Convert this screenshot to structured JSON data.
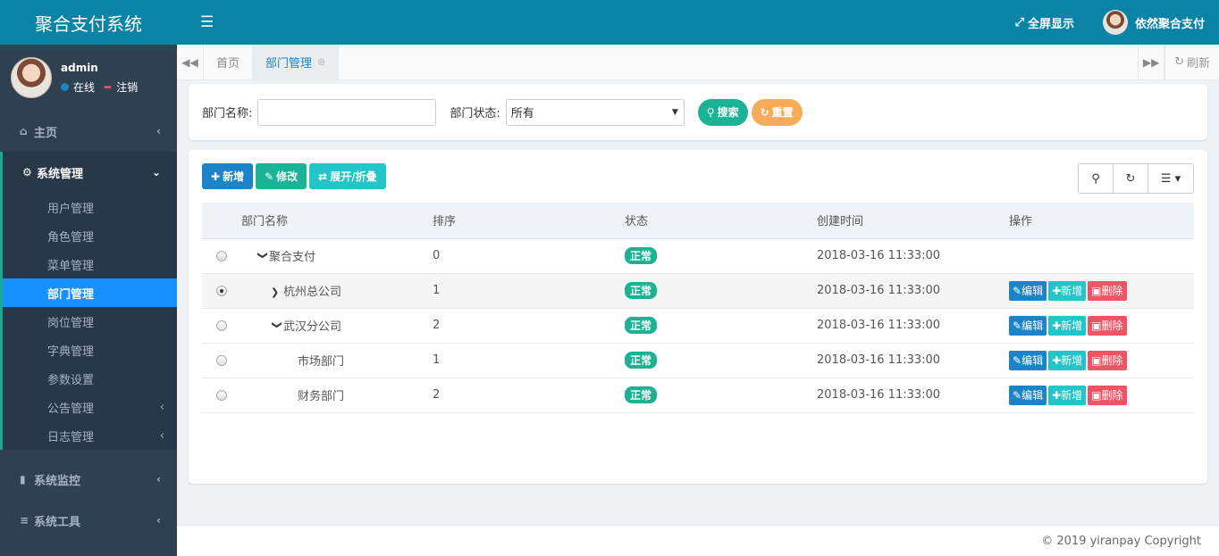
{
  "app": {
    "title": "聚合支付系统"
  },
  "user": {
    "name": "admin",
    "status": "在线",
    "logout": "注销",
    "display_name": "依然聚合支付"
  },
  "topbar": {
    "fullscreen": "全屏显示"
  },
  "sidebar": {
    "items": [
      {
        "label": "主页",
        "icon": "home-icon"
      },
      {
        "label": "系统管理",
        "icon": "gear-icon"
      },
      {
        "label": "系统监控",
        "icon": "video-icon"
      },
      {
        "label": "系统工具",
        "icon": "bars-icon"
      }
    ],
    "sub": [
      "用户管理",
      "角色管理",
      "菜单管理",
      "部门管理",
      "岗位管理",
      "字典管理",
      "参数设置",
      "公告管理",
      "日志管理"
    ]
  },
  "tabs": {
    "home": "首页",
    "current": "部门管理",
    "refresh": "刷新"
  },
  "search": {
    "name_label": "部门名称:",
    "name_value": "",
    "status_label": "部门状态:",
    "status_value": "所有",
    "search_btn": "搜索",
    "reset_btn": "重置"
  },
  "toolbar": {
    "add": "新增",
    "edit": "修改",
    "expand": "展开/折叠"
  },
  "table": {
    "headers": [
      "部门名称",
      "排序",
      "状态",
      "创建时间",
      "操作"
    ],
    "rows": [
      {
        "name": "聚合支付",
        "order": "0",
        "status": "正常",
        "time": "2018-03-16 11:33:00",
        "selected": false
      },
      {
        "name": "杭州总公司",
        "order": "1",
        "status": "正常",
        "time": "2018-03-16 11:33:00",
        "selected": true
      },
      {
        "name": "武汉分公司",
        "order": "2",
        "status": "正常",
        "time": "2018-03-16 11:33:00",
        "selected": false
      },
      {
        "name": "市场部门",
        "order": "1",
        "status": "正常",
        "time": "2018-03-16 11:33:00",
        "selected": false
      },
      {
        "name": "财务部门",
        "order": "2",
        "status": "正常",
        "time": "2018-03-16 11:33:00",
        "selected": false
      }
    ],
    "actions": {
      "edit": "编辑",
      "add": "新增",
      "delete": "删除"
    }
  },
  "footer": {
    "copyright": "© 2019 yiranpay Copyright"
  },
  "colors": {
    "brand": "#0b83a6",
    "sidebar": "#2f4050",
    "active_sub": "#1890ff",
    "primary": "#1c84c6",
    "success": "#1ab394",
    "info": "#23c6c8",
    "danger": "#ed5565",
    "warning": "#f8ac59"
  }
}
